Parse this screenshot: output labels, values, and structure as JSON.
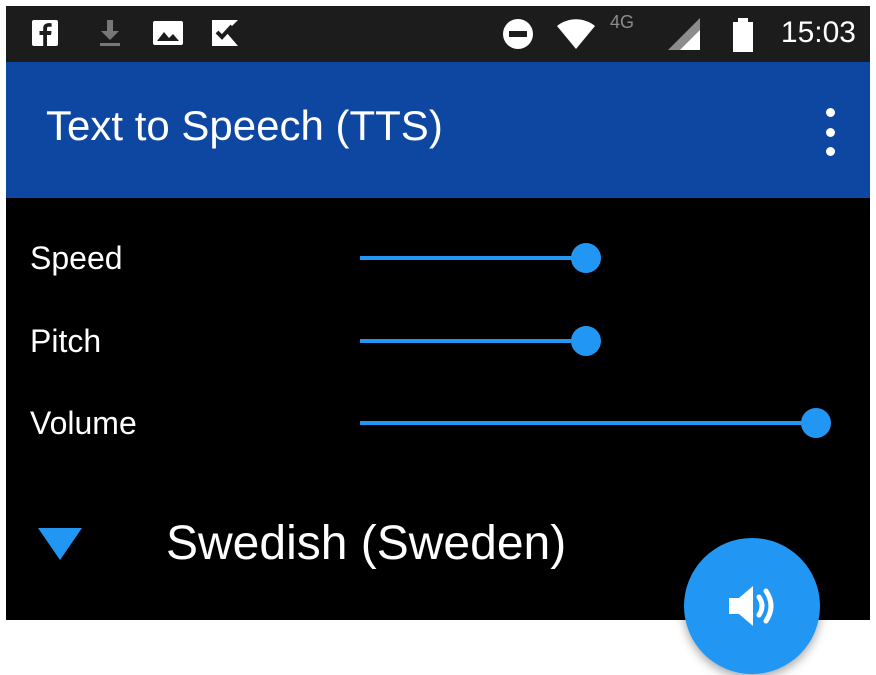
{
  "status_bar": {
    "time": "15:03",
    "network_label": "4G",
    "icons": [
      "facebook-icon",
      "download-icon",
      "image-icon",
      "check-flag-icon",
      "do-not-disturb-icon",
      "wifi-icon",
      "signal-icon",
      "battery-icon"
    ]
  },
  "app_bar": {
    "title": "Text to Speech (TTS)",
    "menu_icon": "more-vert-icon"
  },
  "sliders": [
    {
      "label": "Speed",
      "value_percent": 48
    },
    {
      "label": "Pitch",
      "value_percent": 48
    },
    {
      "label": "Volume",
      "value_percent": 97
    }
  ],
  "language": {
    "selected": "Swedish (Sweden)",
    "icon": "dropdown-triangle-icon"
  },
  "fab": {
    "icon": "speaker-icon"
  },
  "colors": {
    "status_bar_bg": "#1c1c1c",
    "app_bar_bg": "#0d47a1",
    "panel_bg": "#000000",
    "accent": "#2196f3"
  }
}
